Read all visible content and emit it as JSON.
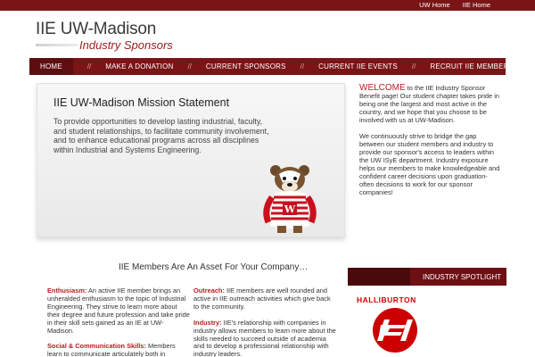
{
  "topbar": {
    "links": [
      "UW Home",
      "IIE Home"
    ]
  },
  "logo": {
    "title": "IIE UW-Madison",
    "subtitle": "Industry Sponsors"
  },
  "nav": {
    "items": [
      "Home",
      "Make a Donation",
      "Current Sponsors",
      "Current IIE Events",
      "Recruit IIE Members"
    ],
    "separator": "//"
  },
  "hero": {
    "title": "IIE UW-Madison Mission Statement",
    "text": "To provide opportunities to develop lasting industrial, faculty, and student relationships, to facilitate community involvement, and to enhance educational programs across all disciplines within Industrial and Systems Engineering."
  },
  "welcome": {
    "lead": "WELCOME",
    "para1": " to the IIE Industry Sponsor Benefit page! Our student chapter takes pride in being one the largest and most active in the country, and we hope that you choose to be involved with us at UW-Madison.",
    "para2": "We continuously strive to bridge the gap between our student members and industry to provide our sponsor's access to leaders within the UW ISyE department. Industry exposure helps our members to make knowledgeable and confident career decisions upon graduation- often decisions to work for our sponsor companies!"
  },
  "members": {
    "title": "IIE Members Are An Asset For Your Company…",
    "left": [
      {
        "term": "Enthusiasm:",
        "text": " An active IIE member brings an unheralded enthusiasm to the topic of Industrial Engineering. They strive to learn more about their degree and future profession and take pride in their skill sets gained as an IE at UW-Madison."
      },
      {
        "term": "Social & Communication Skills:",
        "text": " Members learn to communicate articulately both in"
      }
    ],
    "right": [
      {
        "term": "Outreach:",
        "text": " IIE members are well rounded and active in IIE outreach activities which give back to the community."
      },
      {
        "term": "Industry:",
        "text": " IIE's relationship with companies in industry allows members to learn more about the skills needed to succeed outside of academia and to develop a professional relationship with industry leaders."
      }
    ]
  },
  "spotlight": {
    "title": "INDUSTRY SPOTLIGHT",
    "company": "HALLIBURTON"
  },
  "colors": {
    "brand": "#7a1417",
    "accent": "#b81c22",
    "halliburton": "#cc0000"
  }
}
